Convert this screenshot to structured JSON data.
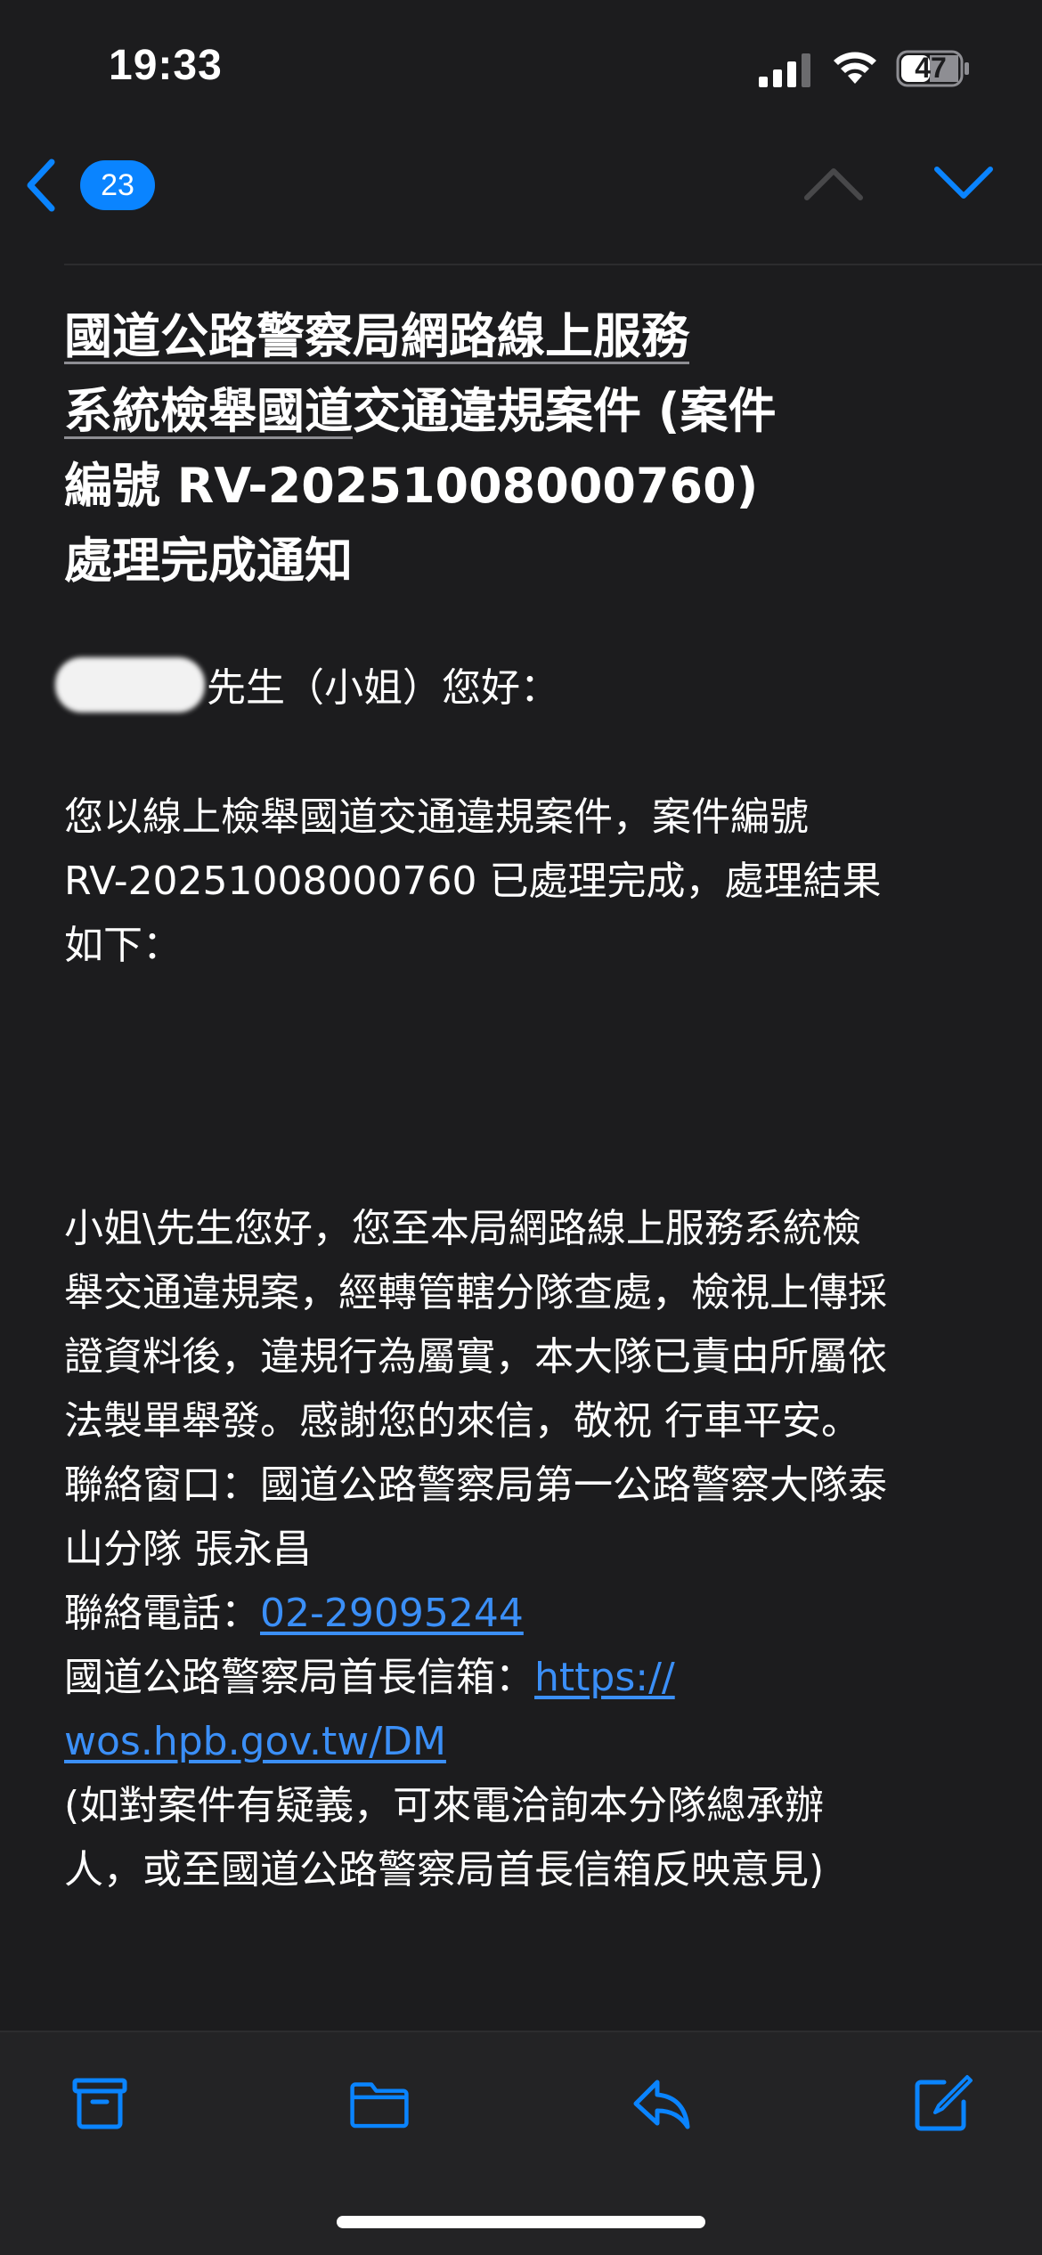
{
  "status_bar": {
    "time": "19:33",
    "battery": "47"
  },
  "nav": {
    "unread_count": "23"
  },
  "email": {
    "subject_line1": "國道公路警察局網路線上服務",
    "subject_line2_underlined": "系統檢舉國道",
    "subject_line2_rest": "交通違規案件 (案件",
    "subject_line3": "編號 RV-20251008000760)",
    "subject_line4": "處理完成通知",
    "greeting": "先生（小姐）您好：",
    "para1_line1": "您以線上檢舉國道交通違規案件，案件編號",
    "para1_line2": "RV-20251008000760 已處理完成，處理結果",
    "para1_line3": "如下：",
    "para2_line1": "小姐\\先生您好，您至本局網路線上服務系統檢",
    "para2_line2": "舉交通違規案，經轉管轄分隊查處，檢視上傳採",
    "para2_line3": "證資料後，違規行為屬實，本大隊已責由所屬依",
    "para2_line4": "法製單舉發。感謝您的來信，敬祝 行車平安。",
    "contact_line1": "聯絡窗口：國道公路警察局第一公路警察大隊泰",
    "contact_line2": "山分隊 張永昌",
    "phone_label": "聯絡電話：",
    "phone_number": "02-29095244",
    "mailbox_label": "國道公路警察局首長信箱：",
    "mailbox_link_part1": "https://",
    "mailbox_link_part2": "wos.hpb.gov.tw/DM",
    "note_line1": "(如對案件有疑義，可來電洽詢本分隊總承辦",
    "note_line2": "人，或至國道公路警察局首長信箱反映意見)"
  },
  "colors": {
    "background": "#1c1c1e",
    "accent": "#0a84ff",
    "link": "#3b8ff7",
    "text": "#ffffff"
  },
  "icons": {
    "back": "chevron-left-icon",
    "prev": "chevron-up-icon",
    "next": "chevron-down-icon",
    "archive": "archive-icon",
    "folder": "folder-icon",
    "reply": "reply-icon",
    "compose": "compose-icon"
  }
}
